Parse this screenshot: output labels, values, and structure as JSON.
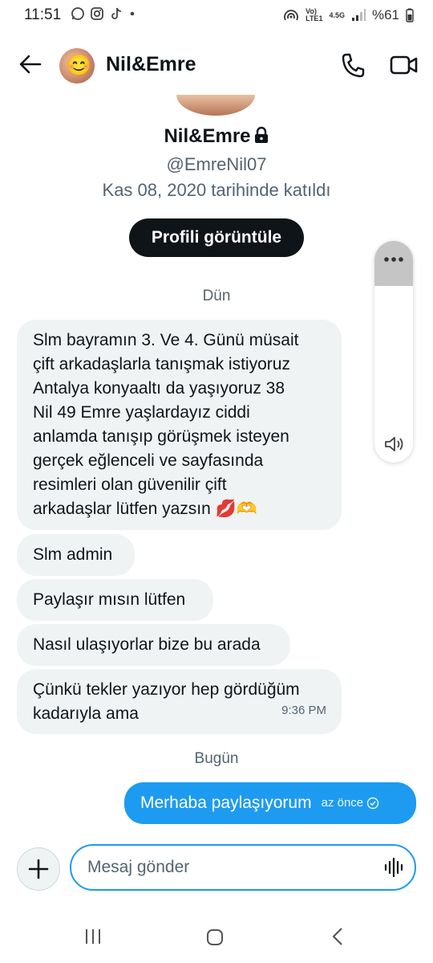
{
  "status_bar": {
    "time": "11:51",
    "left_icons": [
      "whatsapp-icon",
      "instagram-icon",
      "tiktok-icon",
      "dot-icon"
    ],
    "network_label_top": "Vo)",
    "network_label_bottom": "LTE1",
    "network_speed": "4.5G",
    "battery": "%61"
  },
  "header": {
    "title": "Nil&Emre"
  },
  "profile": {
    "name": "Nil&Emre",
    "handle": "@EmreNil07",
    "joined": "Kas 08, 2020 tarihinde katıldı",
    "view_button": "Profili görüntüle"
  },
  "separators": {
    "yesterday": "Dün",
    "today": "Bugün"
  },
  "messages": [
    {
      "lines": [
        "Slm bayramın 3. Ve 4. Günü müsait",
        "çift arkadaşlarla tanışmak istiyoruz",
        "Antalya konyaaltı da yaşıyoruz 38",
        "Nil 49 Emre yaşlardayız ciddi",
        "anlamda tanışıp görüşmek isteyen",
        "gerçek eğlenceli  ve sayfasında",
        "resimleri olan güvenilir çift",
        "arkadaşlar lütfen yazsın 💋🫶"
      ],
      "direction": "in"
    },
    {
      "lines": [
        "Slm admin"
      ],
      "direction": "in"
    },
    {
      "lines": [
        "Paylaşır mısın lütfen"
      ],
      "direction": "in"
    },
    {
      "lines": [
        "Nasıl ulaşıyorlar bize bu arada"
      ],
      "direction": "in"
    },
    {
      "lines": [
        "Çünkü tekler yazıyor hep gördüğüm",
        "kadarıyla ama"
      ],
      "time": "9:36 PM",
      "direction": "in"
    },
    {
      "lines": [
        "Merhaba paylaşıyorum"
      ],
      "time": "az önce",
      "status_icon": "check-circle-icon",
      "direction": "out"
    }
  ],
  "composer": {
    "placeholder": "Mesaj gönder"
  },
  "colors": {
    "accent": "#1d9bf0",
    "incoming_bubble": "#eff3f4",
    "button_dark": "#0f1419",
    "muted_text": "#536471"
  }
}
